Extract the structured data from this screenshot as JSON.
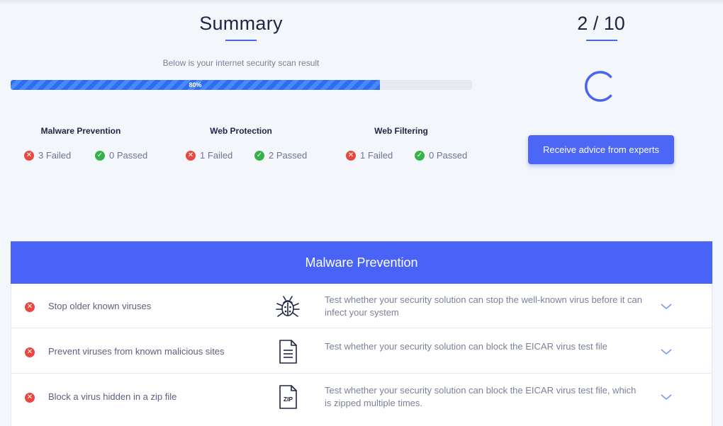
{
  "summary": {
    "title": "Summary",
    "subtitle": "Below is your internet security scan result",
    "progress_label": "80%",
    "progress_value": 0.8
  },
  "counter": {
    "text": "2 / 10"
  },
  "categories": [
    {
      "title": "Malware Prevention",
      "failed": "3 Failed",
      "passed": "0 Passed"
    },
    {
      "title": "Web Protection",
      "failed": "1 Failed",
      "passed": "2 Passed"
    },
    {
      "title": "Web Filtering",
      "failed": "1 Failed",
      "passed": "0 Passed"
    }
  ],
  "advice_button": {
    "label": "Receive advice from experts"
  },
  "section": {
    "title": "Malware Prevention",
    "rows": [
      {
        "title": "Stop older known viruses",
        "icon": "bug-icon",
        "desc": "Test whether your security solution can stop the well-known virus before it can infect your system"
      },
      {
        "title": "Prevent viruses from known malicious sites",
        "icon": "document-icon",
        "desc": "Test whether your security solution can block the EICAR virus test file"
      },
      {
        "title": "Block a virus hidden in a zip file",
        "icon": "zip-file-icon",
        "zip_label": "ZIP",
        "desc": "Test whether your security solution can block the EICAR virus test file, which is zipped multiple times."
      }
    ]
  },
  "colors": {
    "accent": "#4a63f7",
    "fail": "#e8493f",
    "pass": "#36b24a",
    "progress": "#2e6cf0"
  }
}
